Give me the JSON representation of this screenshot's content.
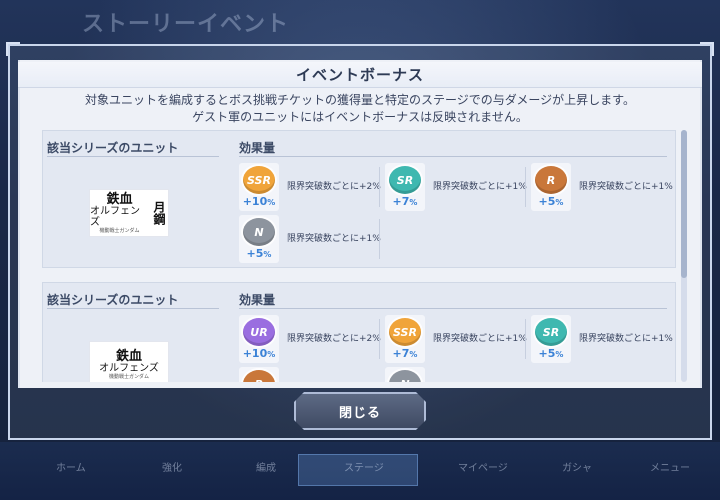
{
  "background": {
    "title": "ストーリーイベント",
    "nav_items": [
      "ホーム",
      "強化",
      "",
      "編成",
      "ステージ",
      "マイページ",
      "ガシャ",
      "メニュー"
    ]
  },
  "dialog": {
    "title": "イベントボーナス",
    "description_line1": "対象ユニットを編成するとボス挑戦チケットの獲得量と特定のステージでの与ダメージが上昇します。",
    "description_line2": "ゲスト軍のユニットにはイベントボーナスは反映されません。",
    "close_label": "閉じる",
    "sections": [
      {
        "series_heading": "該当シリーズのユニット",
        "effect_heading": "効果量",
        "logo": {
          "line1": "鉄血",
          "line2": "オルフェンズ",
          "line3": "機動戦士ガンダム",
          "extra": "月鋼"
        },
        "bonuses": [
          {
            "rarity": "SSR",
            "value": "+10",
            "unit": "%",
            "text": "限界突破数ごとに+2%",
            "color": "#f0a43a"
          },
          {
            "rarity": "SR",
            "value": "+7",
            "unit": "%",
            "text": "限界突破数ごとに+1%",
            "color": "#3fb8b0"
          },
          {
            "rarity": "R",
            "value": "+5",
            "unit": "%",
            "text": "限界突破数ごとに+1%",
            "color": "#c9773a"
          },
          {
            "rarity": "N",
            "value": "+5",
            "unit": "%",
            "text": "限界突破数ごとに+1%",
            "color": "#8d949e"
          }
        ]
      },
      {
        "series_heading": "該当シリーズのユニット",
        "effect_heading": "効果量",
        "logo": {
          "line1": "鉄血",
          "line2": "オルフェンズ",
          "line3": "機動戦士ガンダム",
          "extra": ""
        },
        "bonuses": [
          {
            "rarity": "UR",
            "value": "+10",
            "unit": "%",
            "text": "限界突破数ごとに+2%",
            "color": "#9a6ee0"
          },
          {
            "rarity": "SSR",
            "value": "+7",
            "unit": "%",
            "text": "限界突破数ごとに+1%",
            "color": "#f0a43a"
          },
          {
            "rarity": "SR",
            "value": "+5",
            "unit": "%",
            "text": "限界突破数ごとに+1%",
            "color": "#3fb8b0"
          },
          {
            "rarity": "R",
            "value": "",
            "unit": "",
            "text": "",
            "color": "#c9773a"
          },
          {
            "rarity": "N",
            "value": "",
            "unit": "",
            "text": "",
            "color": "#8d949e"
          }
        ]
      }
    ]
  }
}
